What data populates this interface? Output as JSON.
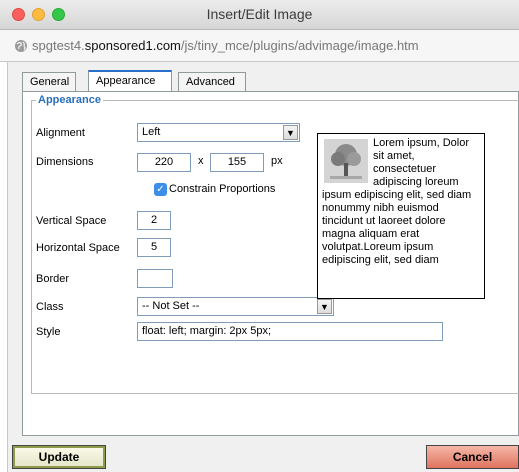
{
  "window": {
    "title": "Insert/Edit Image"
  },
  "address_bar": {
    "url_prefix": "spgtest4.",
    "url_domain": "sponsored1.com",
    "url_path": "/js/tiny_mce/plugins/advimage/image.htm"
  },
  "tabs": [
    {
      "label": "General",
      "active": false
    },
    {
      "label": "Appearance",
      "active": true
    },
    {
      "label": "Advanced",
      "active": false
    }
  ],
  "appearance": {
    "legend": "Appearance",
    "alignment": {
      "label": "Alignment",
      "value": "Left"
    },
    "dimensions": {
      "label": "Dimensions",
      "width": "220",
      "sep": "x",
      "height": "155",
      "unit": "px"
    },
    "constrain": {
      "label": "Constrain Proportions",
      "checked": true
    },
    "vspace": {
      "label": "Vertical Space",
      "value": "2"
    },
    "hspace": {
      "label": "Horizontal Space",
      "value": "5"
    },
    "border": {
      "label": "Border",
      "value": ""
    },
    "class": {
      "label": "Class",
      "value": "-- Not Set --"
    },
    "style": {
      "label": "Style",
      "value": "float: left; margin: 2px 5px;"
    },
    "preview_text": "Lorem ipsum, Dolor sit amet, consectetuer adipiscing loreum ipsum edipiscing elit, sed diam nonummy nibh euismod tincidunt ut laoreet dolore magna aliquam erat volutpat.Loreum ipsum edipiscing elit, sed diam"
  },
  "buttons": {
    "update": "Update",
    "cancel": "Cancel"
  },
  "colors": {
    "accent": "#2b6fb6",
    "checkbox": "#3d8ee8",
    "cancel": "#e0735e"
  },
  "icons": [
    "globe-icon",
    "dropdown-arrow-icon",
    "checkmark-icon",
    "tree-thumbnail-icon"
  ]
}
